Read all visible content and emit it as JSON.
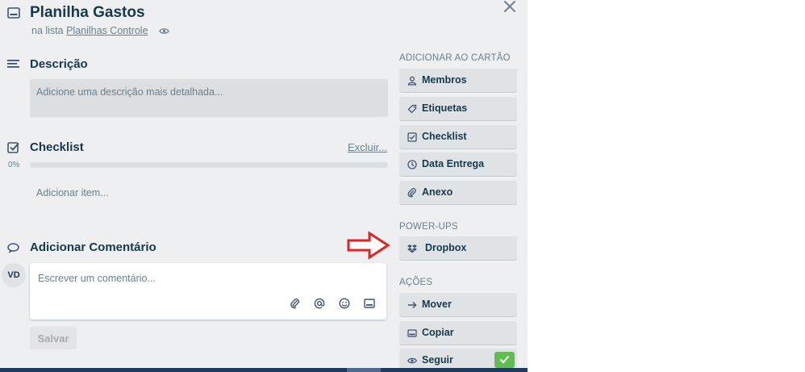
{
  "card": {
    "title": "Planilha Gastos",
    "in_list_prefix": "na lista",
    "list_name": "Planilhas Controle"
  },
  "description": {
    "heading": "Descrição",
    "placeholder": "Adicione uma descrição mais detalhada..."
  },
  "checklist": {
    "heading": "Checklist",
    "delete_label": "Excluir...",
    "progress_label": "0%",
    "progress": 0,
    "add_item_label": "Adicionar item..."
  },
  "comment": {
    "heading": "Adicionar Comentário",
    "avatar_initials": "VD",
    "placeholder": "Escrever um comentário...",
    "save_label": "Salvar",
    "tools": [
      "attachment-icon",
      "mention-icon",
      "emoji-icon",
      "card-icon"
    ]
  },
  "sidebar": {
    "add_heading": "ADICIONAR AO CARTÃO",
    "add_buttons": [
      {
        "label": "Membros",
        "icon": "person-icon"
      },
      {
        "label": "Etiquetas",
        "icon": "tag-icon"
      },
      {
        "label": "Checklist",
        "icon": "checkbox-icon"
      },
      {
        "label": "Data Entrega",
        "icon": "clock-icon"
      },
      {
        "label": "Anexo",
        "icon": "paperclip-icon"
      }
    ],
    "powerups_heading": "POWER-UPS",
    "powerups": [
      {
        "label": "Dropbox",
        "icon": "dropbox-icon"
      }
    ],
    "actions_heading": "AÇÕES",
    "actions": [
      {
        "label": "Mover",
        "icon": "arrow-right-icon"
      },
      {
        "label": "Copiar",
        "icon": "card-icon"
      },
      {
        "label": "Seguir",
        "icon": "eye-icon",
        "active": true
      }
    ]
  },
  "colors": {
    "window_bg": "#edeff0",
    "button_bg": "#dfe3e6",
    "text": "#17394d",
    "muted": "#6b808c",
    "success": "#61bd4f",
    "annotation_arrow": "#e02424"
  }
}
